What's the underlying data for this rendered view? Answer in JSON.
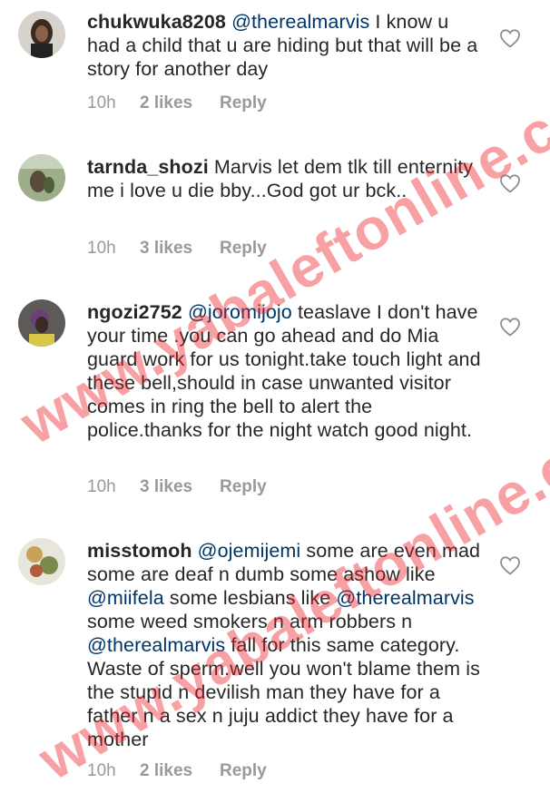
{
  "comments": [
    {
      "username": "chukwuka8208",
      "parts": [
        {
          "text": "@therealmarvis",
          "mention": true
        },
        {
          "text": " I know u had a child that u are hiding but that will be a story for another day",
          "mention": false
        }
      ],
      "time": "10h",
      "likes": "2 likes",
      "reply": "Reply"
    },
    {
      "username": "tarnda_shozi",
      "parts": [
        {
          "text": "Marvis let dem tlk till enternity me i love u die bby...God got ur bck..",
          "mention": false
        }
      ],
      "time": "10h",
      "likes": "3 likes",
      "reply": "Reply"
    },
    {
      "username": "ngozi2752",
      "parts": [
        {
          "text": "@joromijojo",
          "mention": true
        },
        {
          "text": " teaslave I don't have your time .you can go ahead and do Mia guard work for us tonight.take touch light and these bell,should in case unwanted visitor comes in ring the bell to alert the police.thanks for the night watch good night.",
          "mention": false
        }
      ],
      "time": "10h",
      "likes": "3 likes",
      "reply": "Reply"
    },
    {
      "username": "misstomoh",
      "parts": [
        {
          "text": "@ojemijemi",
          "mention": true
        },
        {
          "text": " some are even mad some are deaf n dumb some ashow like ",
          "mention": false
        },
        {
          "text": "@miifela",
          "mention": true
        },
        {
          "text": " some lesbians like ",
          "mention": false
        },
        {
          "text": "@therealmarvis",
          "mention": true
        },
        {
          "text": " some weed smokers n arm robbers n ",
          "mention": false
        },
        {
          "text": "@therealmarvis",
          "mention": true
        },
        {
          "text": " fall for this same category. Waste of sperm.well you won't blame them is the stupid n devilish man they have for a father n a sex n juju addict they have for a mother",
          "mention": false
        }
      ],
      "time": "10h",
      "likes": "2 likes",
      "reply": "Reply"
    }
  ],
  "watermark": "www.yabaleftonline.com",
  "icons": {
    "avatar": "profile-photo",
    "like": "heart-outline-icon"
  },
  "colors": {
    "text": "#262626",
    "mention": "#003569",
    "meta": "#999999",
    "watermark": "#eb1e28"
  }
}
